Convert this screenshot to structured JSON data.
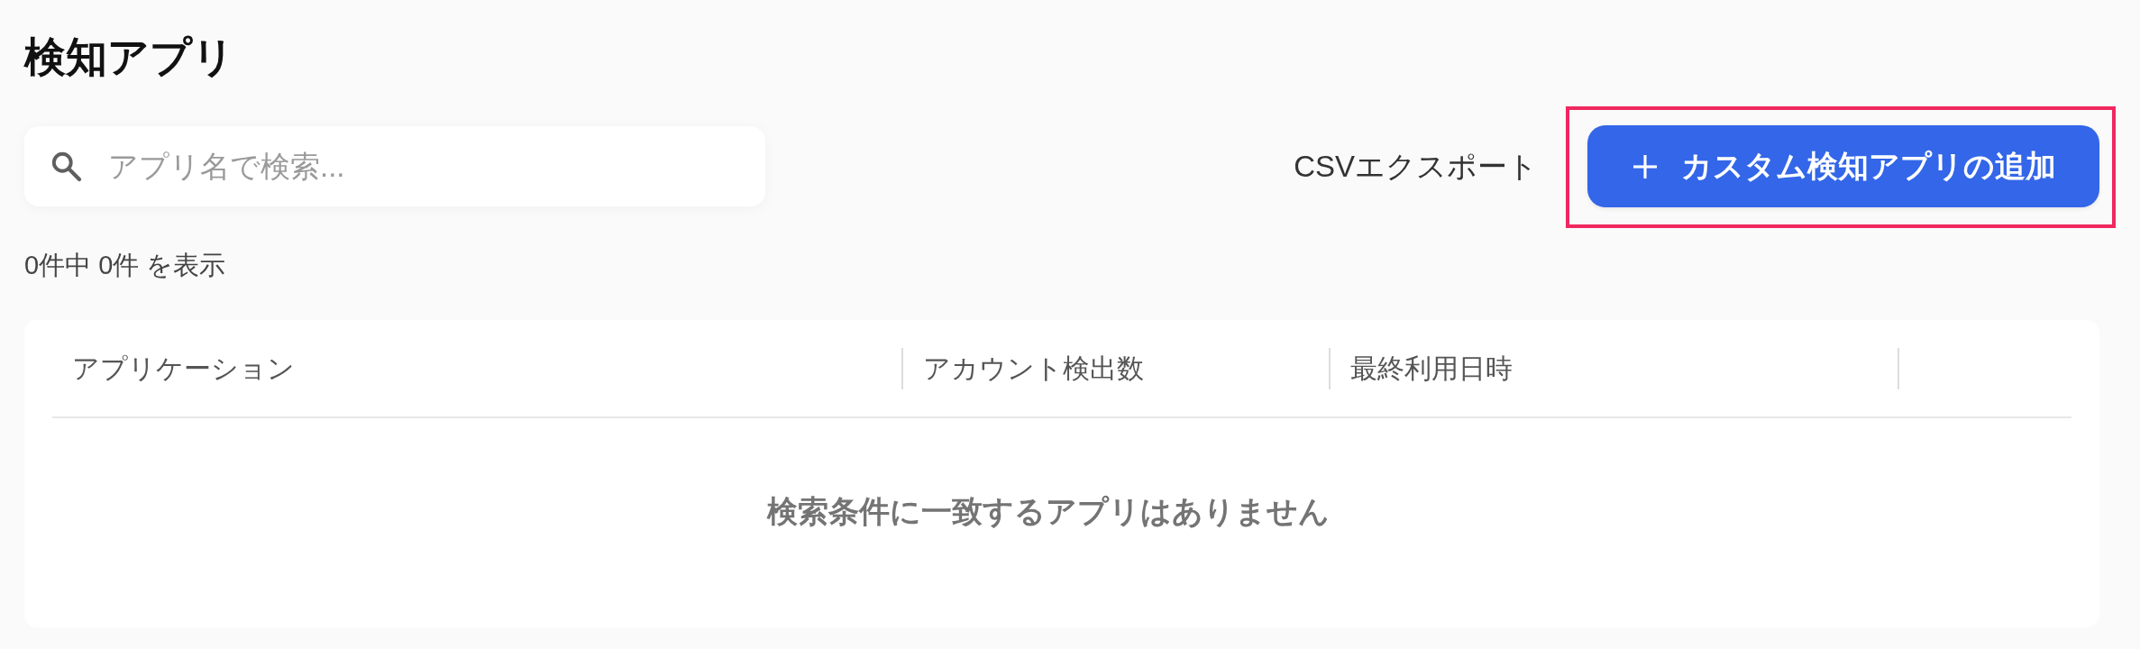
{
  "page": {
    "title": "検知アプリ"
  },
  "toolbar": {
    "search": {
      "placeholder": "アプリ名で検索..."
    },
    "export_link": "CSVエクスポート",
    "add_button": {
      "label": "カスタム検知アプリの追加",
      "highlighted": true
    }
  },
  "result_count": "0件中 0件 を表示",
  "table": {
    "columns": [
      {
        "label": "アプリケーション"
      },
      {
        "label": "アカウント検出数"
      },
      {
        "label": "最終利用日時"
      }
    ],
    "empty_message": "検索条件に一致するアプリはありません"
  }
}
